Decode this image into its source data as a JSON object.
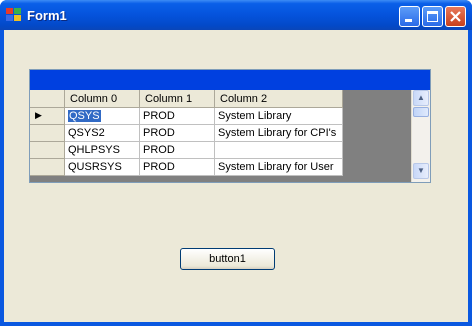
{
  "window": {
    "title": "Form1"
  },
  "grid": {
    "columns": [
      "Column 0",
      "Column 1",
      "Column 2"
    ],
    "rows": [
      [
        "QSYS",
        "PROD",
        "System Library"
      ],
      [
        "QSYS2",
        "PROD",
        "System Library for CPI's"
      ],
      [
        "QHLPSYS",
        "PROD",
        ""
      ],
      [
        "QUSRSYS",
        "PROD",
        "System Library for User"
      ]
    ],
    "current_row_indicator": "▶",
    "scroll_up": "▲",
    "scroll_down": "▼"
  },
  "button1": {
    "label": "button1"
  },
  "colors": {
    "caption": "#0040e0",
    "selection": "#316ac5",
    "form_bg": "#ece9d8"
  }
}
